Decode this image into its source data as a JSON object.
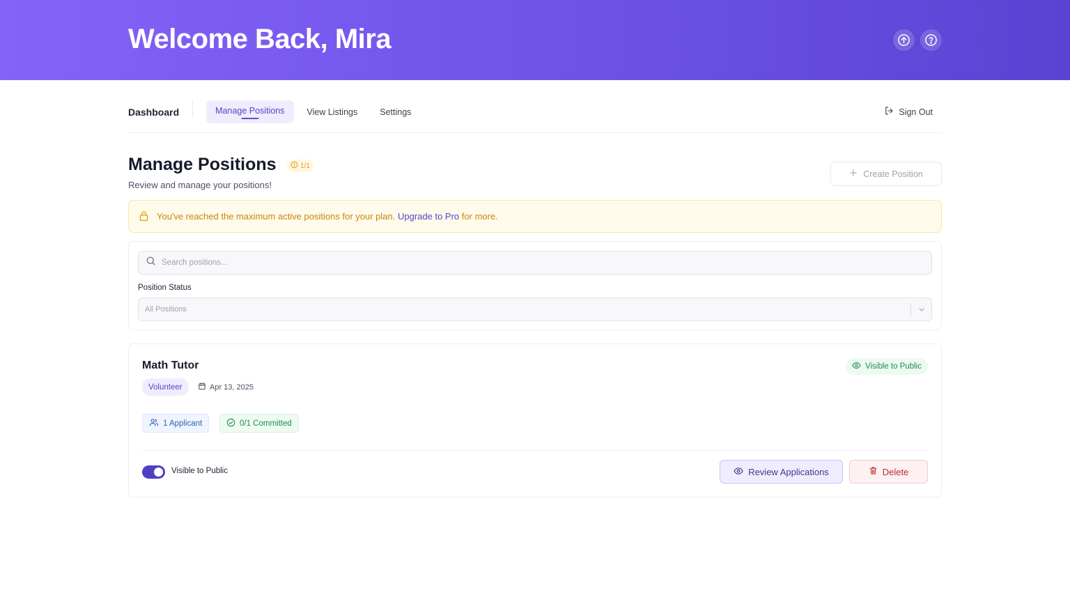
{
  "header": {
    "title": "Welcome Back, Mira",
    "icons": [
      "upload-icon",
      "help-icon"
    ]
  },
  "nav": {
    "brand": "Dashboard",
    "tabs": [
      {
        "label": "Manage Positions",
        "active": true
      },
      {
        "label": "View Listings",
        "active": false
      },
      {
        "label": "Settings",
        "active": false
      }
    ],
    "signout_label": "Sign Out"
  },
  "page": {
    "title": "Manage Positions",
    "count_badge": "1/1",
    "subtitle": "Review and manage your positions!",
    "create_label": "Create Position"
  },
  "alert": {
    "text_before": "You've reached the maximum active positions for your plan.",
    "link_text": "Upgrade to Pro",
    "text_after": "for more."
  },
  "filters": {
    "search_placeholder": "Search positions...",
    "status_label": "Position Status",
    "status_value": "All Positions"
  },
  "position": {
    "title": "Math Tutor",
    "visibility_badge": "Visible to Public",
    "type": "Volunteer",
    "date": "Apr 13, 2025",
    "applicants": "1 Applicant",
    "committed": "0/1 Committed",
    "toggle_on": true,
    "toggle_label": "Visible to Public",
    "review_label": "Review Applications",
    "delete_label": "Delete"
  },
  "colors": {
    "header_gradient_start": "#8463f8",
    "header_gradient_end": "#5a43d3",
    "accent": "#4f46c9",
    "warning": "#c98312",
    "success": "#1f8a4c",
    "danger": "#c0292b"
  }
}
